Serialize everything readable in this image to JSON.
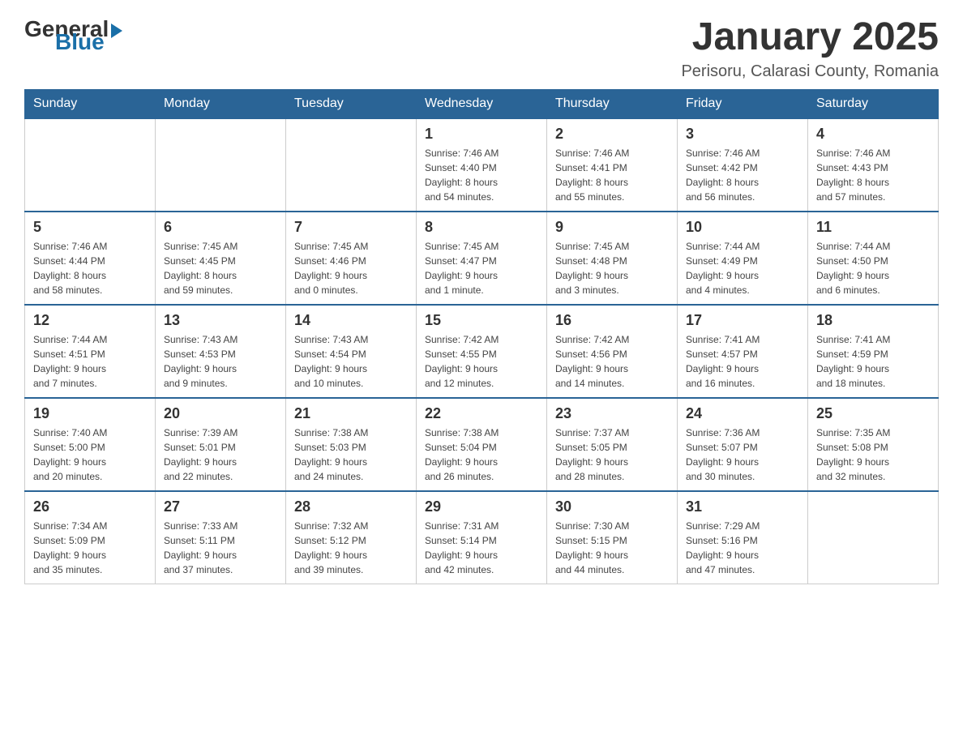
{
  "header": {
    "logo_general": "General",
    "logo_blue": "Blue",
    "month_title": "January 2025",
    "location": "Perisoru, Calarasi County, Romania"
  },
  "days_of_week": [
    "Sunday",
    "Monday",
    "Tuesday",
    "Wednesday",
    "Thursday",
    "Friday",
    "Saturday"
  ],
  "weeks": [
    [
      {
        "day": "",
        "info": ""
      },
      {
        "day": "",
        "info": ""
      },
      {
        "day": "",
        "info": ""
      },
      {
        "day": "1",
        "info": "Sunrise: 7:46 AM\nSunset: 4:40 PM\nDaylight: 8 hours\nand 54 minutes."
      },
      {
        "day": "2",
        "info": "Sunrise: 7:46 AM\nSunset: 4:41 PM\nDaylight: 8 hours\nand 55 minutes."
      },
      {
        "day": "3",
        "info": "Sunrise: 7:46 AM\nSunset: 4:42 PM\nDaylight: 8 hours\nand 56 minutes."
      },
      {
        "day": "4",
        "info": "Sunrise: 7:46 AM\nSunset: 4:43 PM\nDaylight: 8 hours\nand 57 minutes."
      }
    ],
    [
      {
        "day": "5",
        "info": "Sunrise: 7:46 AM\nSunset: 4:44 PM\nDaylight: 8 hours\nand 58 minutes."
      },
      {
        "day": "6",
        "info": "Sunrise: 7:45 AM\nSunset: 4:45 PM\nDaylight: 8 hours\nand 59 minutes."
      },
      {
        "day": "7",
        "info": "Sunrise: 7:45 AM\nSunset: 4:46 PM\nDaylight: 9 hours\nand 0 minutes."
      },
      {
        "day": "8",
        "info": "Sunrise: 7:45 AM\nSunset: 4:47 PM\nDaylight: 9 hours\nand 1 minute."
      },
      {
        "day": "9",
        "info": "Sunrise: 7:45 AM\nSunset: 4:48 PM\nDaylight: 9 hours\nand 3 minutes."
      },
      {
        "day": "10",
        "info": "Sunrise: 7:44 AM\nSunset: 4:49 PM\nDaylight: 9 hours\nand 4 minutes."
      },
      {
        "day": "11",
        "info": "Sunrise: 7:44 AM\nSunset: 4:50 PM\nDaylight: 9 hours\nand 6 minutes."
      }
    ],
    [
      {
        "day": "12",
        "info": "Sunrise: 7:44 AM\nSunset: 4:51 PM\nDaylight: 9 hours\nand 7 minutes."
      },
      {
        "day": "13",
        "info": "Sunrise: 7:43 AM\nSunset: 4:53 PM\nDaylight: 9 hours\nand 9 minutes."
      },
      {
        "day": "14",
        "info": "Sunrise: 7:43 AM\nSunset: 4:54 PM\nDaylight: 9 hours\nand 10 minutes."
      },
      {
        "day": "15",
        "info": "Sunrise: 7:42 AM\nSunset: 4:55 PM\nDaylight: 9 hours\nand 12 minutes."
      },
      {
        "day": "16",
        "info": "Sunrise: 7:42 AM\nSunset: 4:56 PM\nDaylight: 9 hours\nand 14 minutes."
      },
      {
        "day": "17",
        "info": "Sunrise: 7:41 AM\nSunset: 4:57 PM\nDaylight: 9 hours\nand 16 minutes."
      },
      {
        "day": "18",
        "info": "Sunrise: 7:41 AM\nSunset: 4:59 PM\nDaylight: 9 hours\nand 18 minutes."
      }
    ],
    [
      {
        "day": "19",
        "info": "Sunrise: 7:40 AM\nSunset: 5:00 PM\nDaylight: 9 hours\nand 20 minutes."
      },
      {
        "day": "20",
        "info": "Sunrise: 7:39 AM\nSunset: 5:01 PM\nDaylight: 9 hours\nand 22 minutes."
      },
      {
        "day": "21",
        "info": "Sunrise: 7:38 AM\nSunset: 5:03 PM\nDaylight: 9 hours\nand 24 minutes."
      },
      {
        "day": "22",
        "info": "Sunrise: 7:38 AM\nSunset: 5:04 PM\nDaylight: 9 hours\nand 26 minutes."
      },
      {
        "day": "23",
        "info": "Sunrise: 7:37 AM\nSunset: 5:05 PM\nDaylight: 9 hours\nand 28 minutes."
      },
      {
        "day": "24",
        "info": "Sunrise: 7:36 AM\nSunset: 5:07 PM\nDaylight: 9 hours\nand 30 minutes."
      },
      {
        "day": "25",
        "info": "Sunrise: 7:35 AM\nSunset: 5:08 PM\nDaylight: 9 hours\nand 32 minutes."
      }
    ],
    [
      {
        "day": "26",
        "info": "Sunrise: 7:34 AM\nSunset: 5:09 PM\nDaylight: 9 hours\nand 35 minutes."
      },
      {
        "day": "27",
        "info": "Sunrise: 7:33 AM\nSunset: 5:11 PM\nDaylight: 9 hours\nand 37 minutes."
      },
      {
        "day": "28",
        "info": "Sunrise: 7:32 AM\nSunset: 5:12 PM\nDaylight: 9 hours\nand 39 minutes."
      },
      {
        "day": "29",
        "info": "Sunrise: 7:31 AM\nSunset: 5:14 PM\nDaylight: 9 hours\nand 42 minutes."
      },
      {
        "day": "30",
        "info": "Sunrise: 7:30 AM\nSunset: 5:15 PM\nDaylight: 9 hours\nand 44 minutes."
      },
      {
        "day": "31",
        "info": "Sunrise: 7:29 AM\nSunset: 5:16 PM\nDaylight: 9 hours\nand 47 minutes."
      },
      {
        "day": "",
        "info": ""
      }
    ]
  ]
}
